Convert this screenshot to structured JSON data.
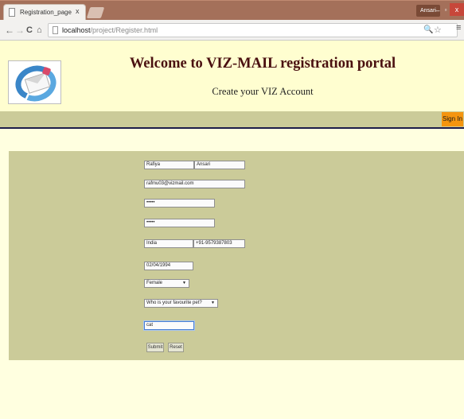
{
  "browser": {
    "tab_title": "Registration_page",
    "tab_close": "x",
    "user_name": "Ansari",
    "win_min": "–",
    "win_max": "▫",
    "win_close": "x",
    "url_host": "localhost",
    "url_path": "/project/Register.html",
    "nav_back": "←",
    "nav_forward": "→",
    "nav_reload": "C",
    "nav_home": "⌂",
    "zoom_glyph": "🔍",
    "star_glyph": "☆",
    "menu_glyph": "≡"
  },
  "header": {
    "title": "Welcome to VIZ-MAIL registration portal",
    "subtitle": "Create your VIZ Account",
    "sign_in_label": "Sign In"
  },
  "form": {
    "first_name": "Rafiya",
    "last_name": "Ansari",
    "email": "rafmu03@vizmail.com",
    "password": "•••••",
    "confirm_password": "•••••",
    "country": "India",
    "phone": "+91-9579387803",
    "dob": "02/04/1994",
    "gender": "Female",
    "security_question": "Who is your favourite pet?",
    "security_answer": "cat",
    "submit_label": "Submit",
    "reset_label": "Reset"
  },
  "colors": {
    "titlebar": "#a4705a",
    "page_background": "#ffffe0",
    "khaki_band": "#cbcb99",
    "sign_in_button": "#f5950f",
    "title_text": "#4a1010",
    "divider": "#1c1c4a"
  },
  "icons": {
    "logo": "mail-envelope-sync-logo",
    "tab": "page-icon",
    "url": "page-icon"
  }
}
